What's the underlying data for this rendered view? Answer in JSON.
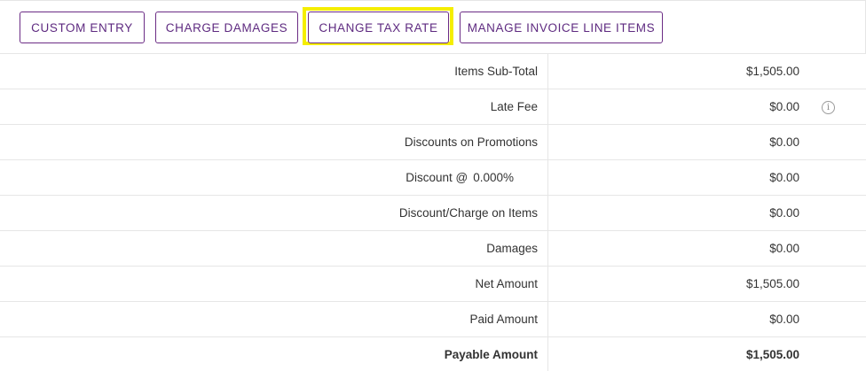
{
  "toolbar": {
    "custom_entry": "CUSTOM ENTRY",
    "charge_damages": "CHARGE DAMAGES",
    "change_tax_rate": "CHANGE TAX RATE",
    "manage_invoice_line_items": "MANAGE INVOICE LINE ITEMS"
  },
  "summary": {
    "items_subtotal": {
      "label": "Items Sub-Total",
      "value": "$1,505.00"
    },
    "late_fee": {
      "label": "Late Fee",
      "value": "$0.00",
      "icon": "info-icon"
    },
    "discounts_promotions": {
      "label": "Discounts on Promotions",
      "value": "$0.00"
    },
    "discount_rate": {
      "label": "Discount @",
      "rate": "0.000%",
      "value": "$0.00"
    },
    "discount_charge_items": {
      "label": "Discount/Charge on Items",
      "value": "$0.00"
    },
    "damages": {
      "label": "Damages",
      "value": "$0.00"
    },
    "net_amount": {
      "label": "Net Amount",
      "value": "$1,505.00"
    },
    "paid_amount": {
      "label": "Paid Amount",
      "value": "$0.00"
    },
    "payable_amount": {
      "label": "Payable Amount",
      "value": "$1,505.00"
    }
  },
  "colors": {
    "button_border": "#6b2c85",
    "button_text": "#5e2a80",
    "highlight": "#f5ee00",
    "row_border": "#e6e6e6"
  }
}
